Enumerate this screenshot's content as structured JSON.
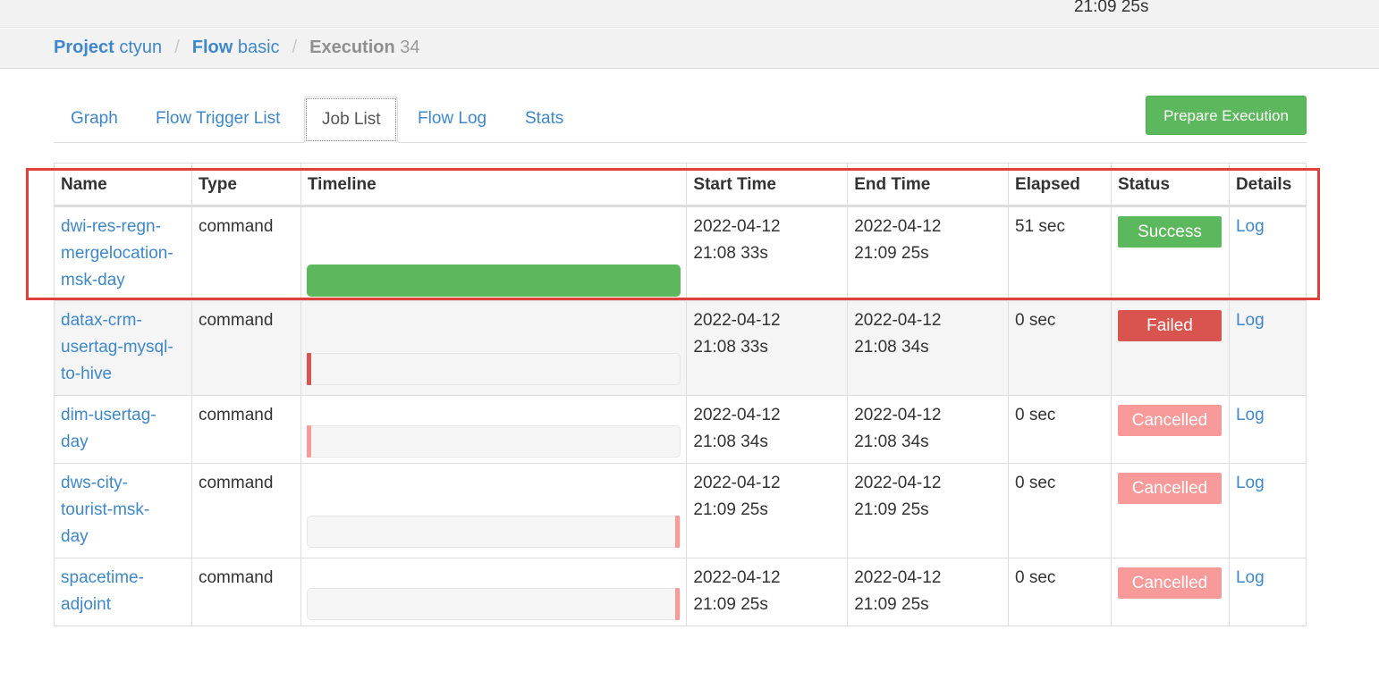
{
  "top_time": "21:09 25s",
  "breadcrumb": {
    "project_label": "Project",
    "project_name": "ctyun",
    "flow_label": "Flow",
    "flow_name": "basic",
    "execution_label": "Execution",
    "execution_id": "34",
    "separator": "/"
  },
  "tabs": [
    {
      "label": "Graph",
      "active": false
    },
    {
      "label": "Flow Trigger List",
      "active": false
    },
    {
      "label": "Job List",
      "active": true
    },
    {
      "label": "Flow Log",
      "active": false
    },
    {
      "label": "Stats",
      "active": false
    }
  ],
  "prepare_button": "Prepare Execution",
  "table": {
    "headers": [
      "Name",
      "Type",
      "Timeline",
      "Start Time",
      "End Time",
      "Elapsed",
      "Status",
      "Details"
    ],
    "rows": [
      {
        "name_lines": [
          "dwi-res-regn-",
          "mergelocation-",
          "msk-day"
        ],
        "type": "command",
        "start_date": "2022-04-12",
        "start_time": "21:08 33s",
        "end_date": "2022-04-12",
        "end_time": "21:09 25s",
        "elapsed": "51 sec",
        "status": "Success",
        "details": "Log",
        "timeline_start_pct": 0,
        "timeline_width_pct": 100
      },
      {
        "name_lines": [
          "datax-crm-",
          "usertag-mysql-",
          "to-hive"
        ],
        "type": "command",
        "start_date": "2022-04-12",
        "start_time": "21:08 33s",
        "end_date": "2022-04-12",
        "end_time": "21:08 34s",
        "elapsed": "0 sec",
        "status": "Failed",
        "details": "Log",
        "timeline_start_pct": 0,
        "timeline_width_pct": 1
      },
      {
        "name_lines": [
          "dim-usertag-",
          "day"
        ],
        "type": "command",
        "start_date": "2022-04-12",
        "start_time": "21:08 34s",
        "end_date": "2022-04-12",
        "end_time": "21:08 34s",
        "elapsed": "0 sec",
        "status": "Cancelled",
        "details": "Log",
        "timeline_start_pct": 0,
        "timeline_width_pct": 1
      },
      {
        "name_lines": [
          "dws-city-",
          "tourist-msk-",
          "day"
        ],
        "type": "command",
        "start_date": "2022-04-12",
        "start_time": "21:09 25s",
        "end_date": "2022-04-12",
        "end_time": "21:09 25s",
        "elapsed": "0 sec",
        "status": "Cancelled",
        "details": "Log",
        "timeline_start_pct": 99,
        "timeline_width_pct": 1
      },
      {
        "name_lines": [
          "spacetime-",
          "adjoint"
        ],
        "type": "command",
        "start_date": "2022-04-12",
        "start_time": "21:09 25s",
        "end_date": "2022-04-12",
        "end_time": "21:09 25s",
        "elapsed": "0 sec",
        "status": "Cancelled",
        "details": "Log",
        "timeline_start_pct": 99,
        "timeline_width_pct": 1
      }
    ]
  },
  "colors": {
    "link": "#3f87c9",
    "success": "#5cb85c",
    "failed": "#d9534f",
    "cancelled": "#f89a9a",
    "highlight": "#e0403c"
  }
}
